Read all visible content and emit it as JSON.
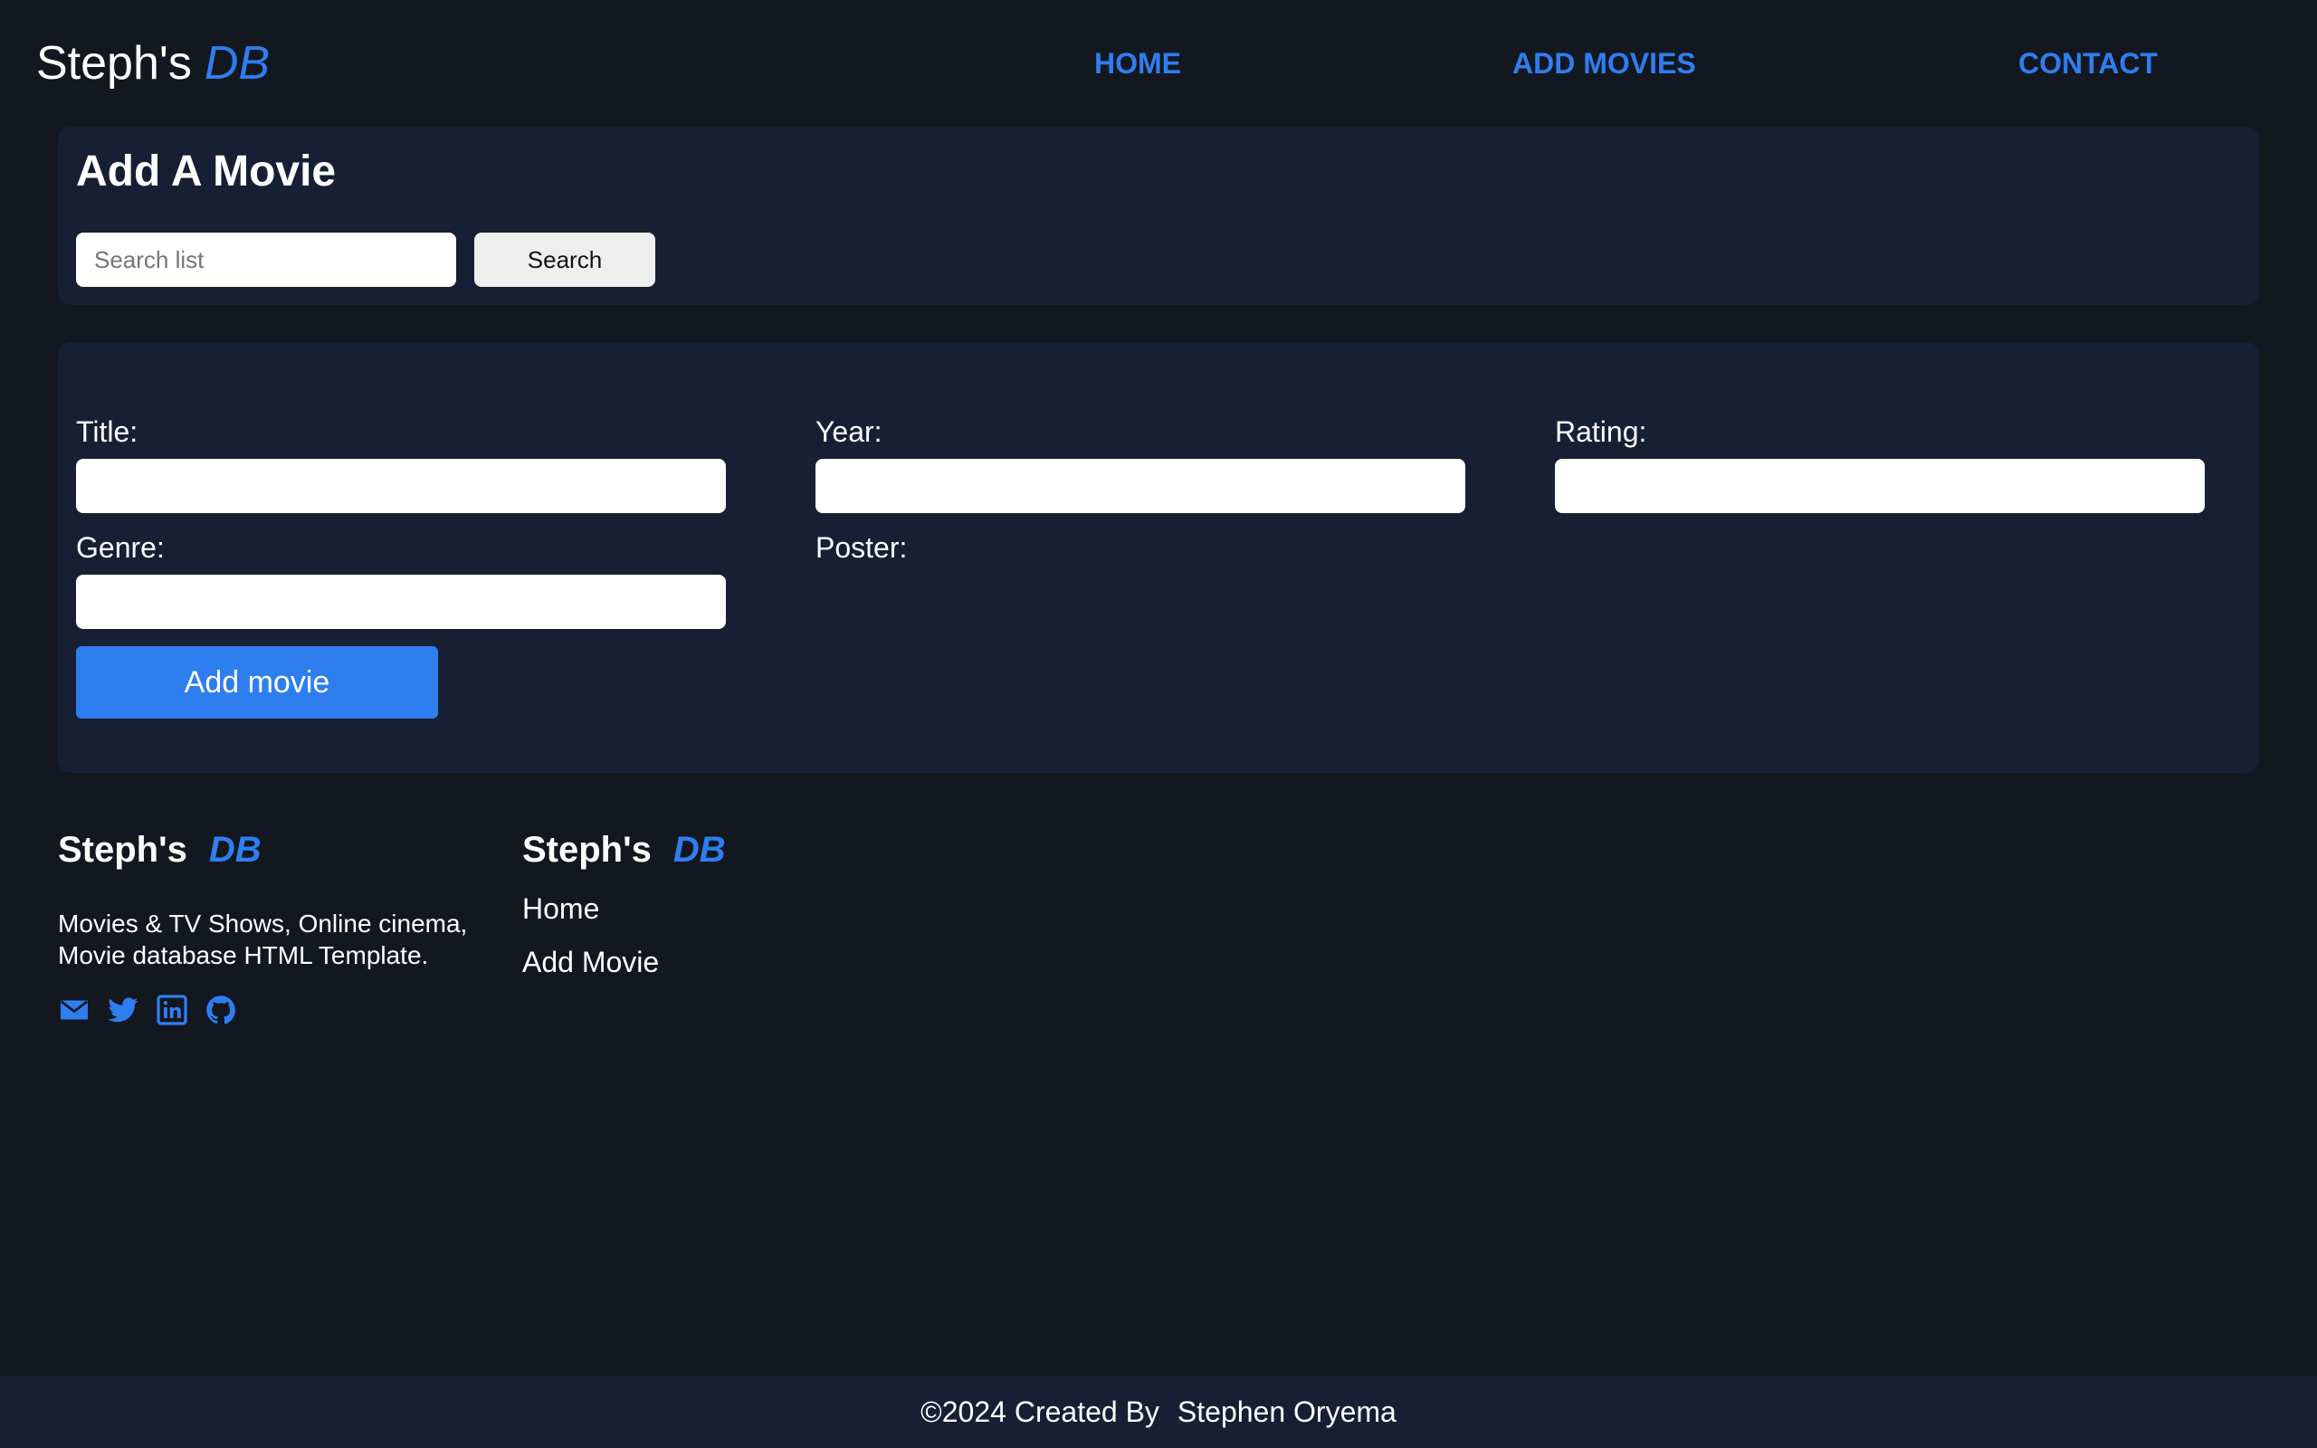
{
  "header": {
    "logo_main": "Steph's",
    "logo_accent": "DB",
    "nav": {
      "home": "HOME",
      "add_movies": "ADD MOVIES",
      "contact": "CONTACT"
    }
  },
  "search_panel": {
    "title": "Add A Movie",
    "search_placeholder": "Search list",
    "search_value": "",
    "search_button": "Search"
  },
  "movie_form": {
    "title_label": "Title:",
    "title_value": "",
    "year_label": "Year:",
    "year_value": "",
    "rating_label": "Rating:",
    "rating_value": "",
    "genre_label": "Genre:",
    "genre_value": "",
    "poster_label": "Poster:",
    "submit_button": "Add movie"
  },
  "footer": {
    "brand_main": "Steph's",
    "brand_accent": "DB",
    "description": "Movies & TV Shows, Online cinema, Movie database HTML Template.",
    "social_icons": [
      "envelope-icon",
      "twitter-icon",
      "linkedin-icon",
      "github-icon"
    ],
    "links_heading_main": "Steph's",
    "links_heading_accent": "DB",
    "links": {
      "home": "Home",
      "add_movie": "Add Movie"
    },
    "copyright": "©2024 Created By",
    "author": "Stephen Oryema"
  },
  "colors": {
    "background": "#121720",
    "panel": "#161f33",
    "accent": "#2f7ef0",
    "text": "#ffffff"
  }
}
